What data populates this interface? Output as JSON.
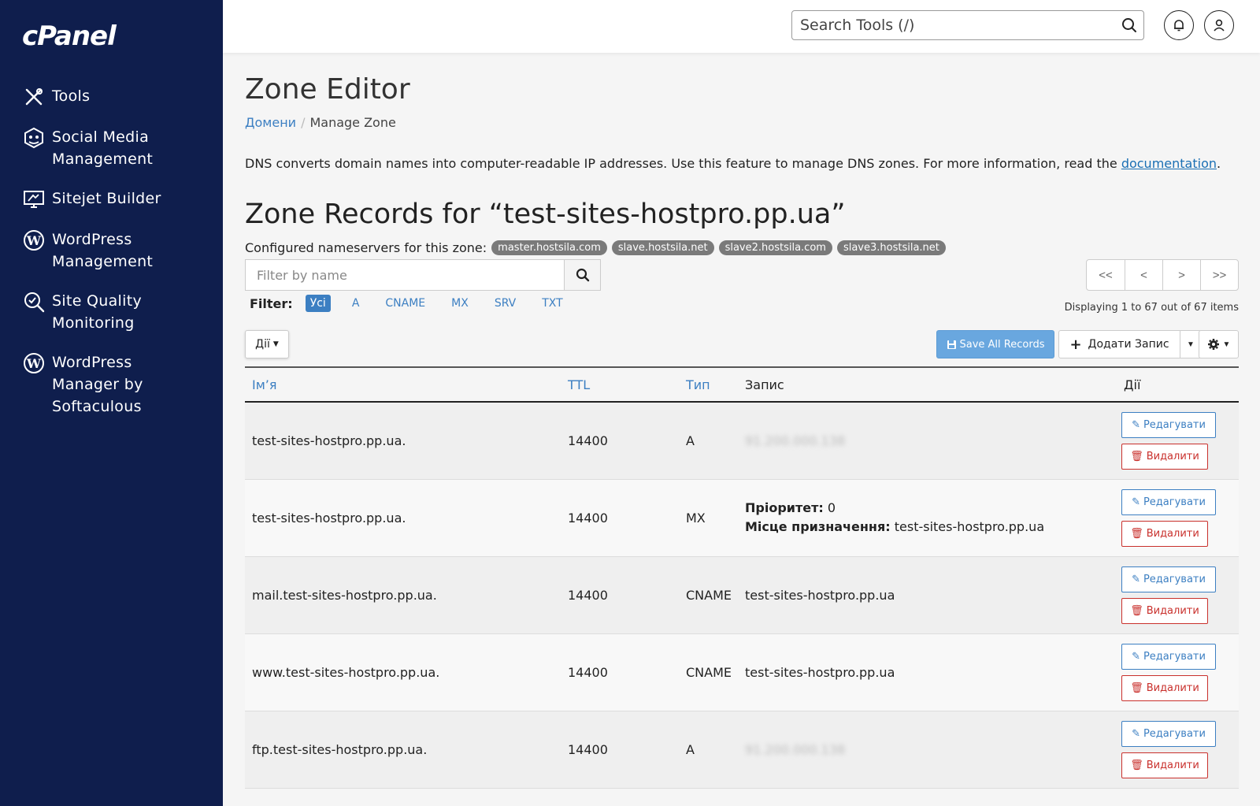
{
  "brand": {
    "logo_text": "cPanel"
  },
  "sidebar": {
    "items": [
      {
        "label": "Tools",
        "icon": "tools-icon"
      },
      {
        "label": "Social Media Management",
        "icon": "social-media-icon"
      },
      {
        "label": "Sitejet Builder",
        "icon": "sitejet-icon"
      },
      {
        "label": "WordPress Management",
        "icon": "wordpress-icon"
      },
      {
        "label": "Site Quality Monitoring",
        "icon": "site-quality-icon"
      },
      {
        "label": "WordPress Manager by Softaculous",
        "icon": "wordpress-icon"
      }
    ]
  },
  "topbar": {
    "search_placeholder": "Search Tools (/)"
  },
  "page": {
    "title": "Zone Editor",
    "breadcrumb": {
      "parent": "Домени",
      "current": "Manage Zone"
    },
    "description": "DNS converts domain names into computer-readable IP addresses. Use this feature to manage DNS zones. For more information, read the ",
    "description_link": "documentation",
    "description_end": "."
  },
  "zone": {
    "title": "Zone Records for “test-sites-hostpro.pp.ua”",
    "nameservers_label": "Configured nameservers for this zone:",
    "nameservers": [
      "master.hostsila.com",
      "slave.hostsila.net",
      "slave2.hostsila.com",
      "slave3.hostsila.net"
    ]
  },
  "filter": {
    "placeholder": "Filter by name",
    "label": "Filter:",
    "options": [
      "Усі",
      "A",
      "CNAME",
      "MX",
      "SRV",
      "TXT"
    ],
    "active": "Усі"
  },
  "pager": {
    "buttons": [
      "<<",
      "<",
      ">",
      ">>"
    ],
    "displaying": "Displaying 1 to 67 out of 67 items"
  },
  "toolbar": {
    "actions_label": "Дії",
    "save_label": "Save All Records",
    "add_label": "Додати Запис"
  },
  "table": {
    "headers": {
      "name": "Ім’я",
      "ttl": "TTL",
      "type": "Тип",
      "record": "Запис",
      "actions": "Дії"
    },
    "edit_label": "Редагувати",
    "delete_label": "Видалити",
    "rows": [
      {
        "name": "test-sites-hostpro.pp.ua.",
        "ttl": "14400",
        "type": "A",
        "record": "91.200.000.138"
      },
      {
        "name": "test-sites-hostpro.pp.ua.",
        "ttl": "14400",
        "type": "MX",
        "priority_label": "Пріоритет:",
        "priority": "0",
        "dest_label": "Місце призначення:",
        "dest": "test-sites-hostpro.pp.ua"
      },
      {
        "name": "mail.test-sites-hostpro.pp.ua.",
        "ttl": "14400",
        "type": "CNAME",
        "record": "test-sites-hostpro.pp.ua"
      },
      {
        "name": "www.test-sites-hostpro.pp.ua.",
        "ttl": "14400",
        "type": "CNAME",
        "record": "test-sites-hostpro.pp.ua"
      },
      {
        "name": "ftp.test-sites-hostpro.pp.ua.",
        "ttl": "14400",
        "type": "A",
        "record": "91.200.000.138"
      }
    ]
  },
  "colors": {
    "sidebar_bg": "#0f1e4d",
    "link": "#3c7fc2",
    "save_btn": "#69a7df",
    "danger": "#c9302c",
    "badge": "#7a7a7a"
  }
}
